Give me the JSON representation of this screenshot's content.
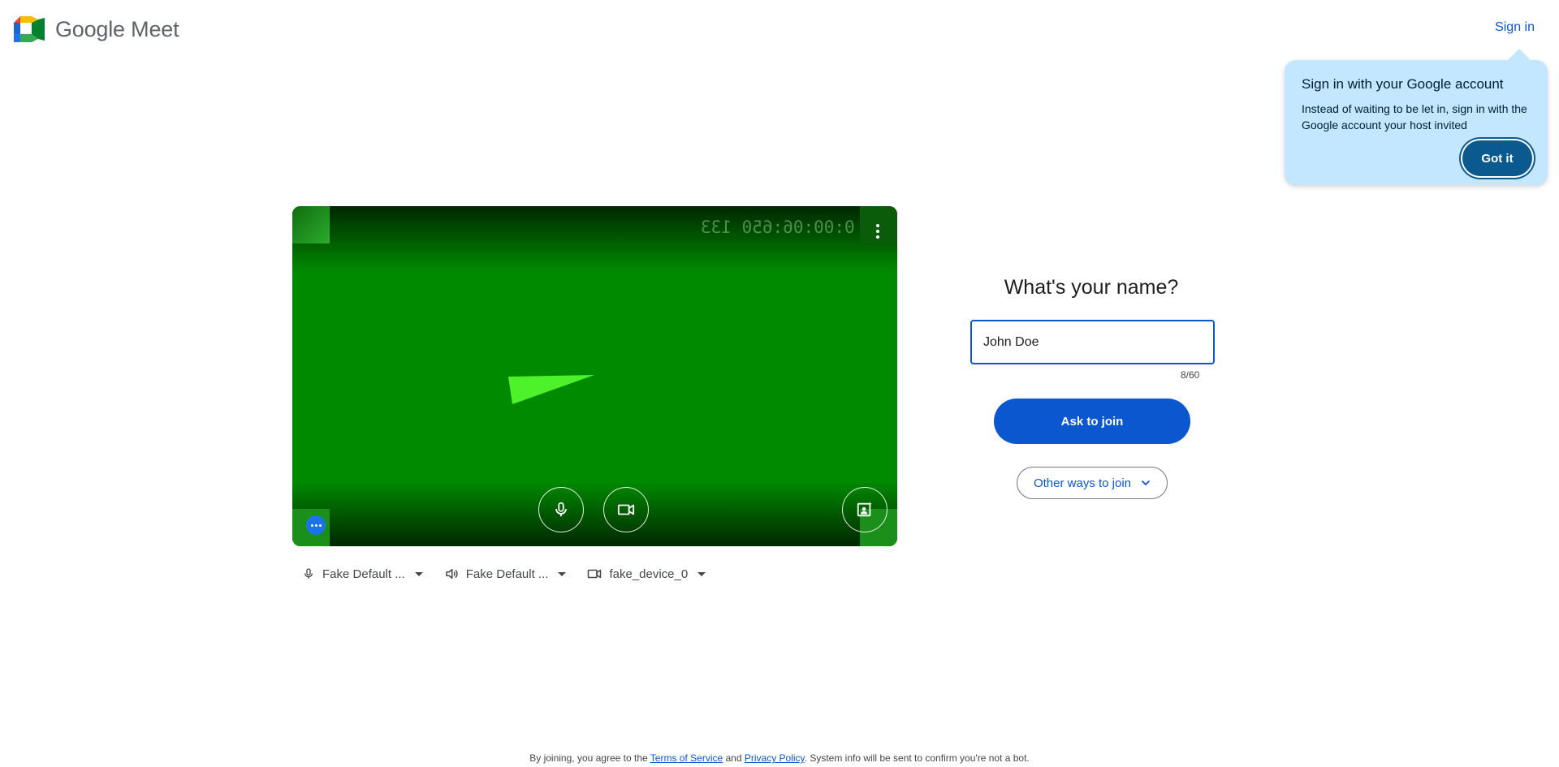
{
  "header": {
    "app_name": "Google Meet",
    "sign_in_label": "Sign in"
  },
  "callout": {
    "title": "Sign in with your Google account",
    "body": "Instead of waiting to be let in, sign in with the Google account your host invited",
    "button_label": "Got it"
  },
  "preview": {
    "timestamp": "0:00:06:650 133",
    "buttons": [
      "mic-icon",
      "camera-icon",
      "visual-effects-icon",
      "more-options-icon"
    ]
  },
  "devices": {
    "microphone": "Fake Default ...",
    "speaker": "Fake Default ...",
    "camera": "fake_device_0"
  },
  "join": {
    "title": "What's your name?",
    "name_value": "John Doe",
    "char_count": "8/60",
    "ask_label": "Ask to join",
    "other_ways_label": "Other ways to join"
  },
  "footer": {
    "prefix": "By joining, you agree to the ",
    "terms": "Terms of Service",
    "and": " and ",
    "privacy": "Privacy Policy",
    "suffix": ". System info will be sent to confirm you're not a bot."
  },
  "colors": {
    "accent": "#0b57d0",
    "callout_bg": "#c2e7ff",
    "preview_green": "#008a00"
  }
}
